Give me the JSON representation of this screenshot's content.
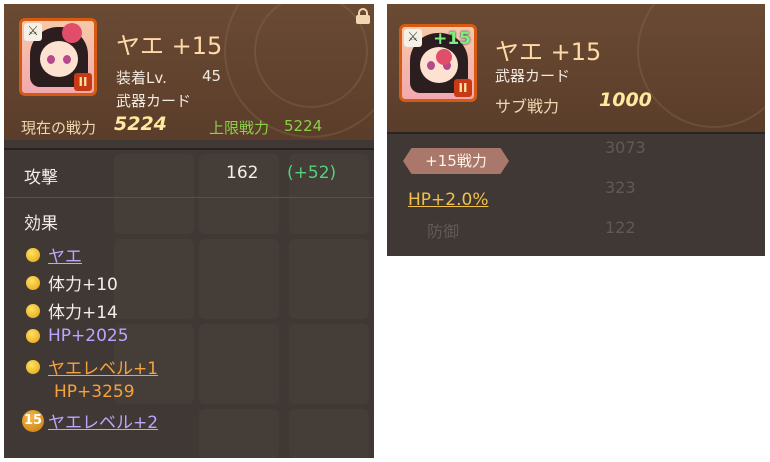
{
  "left_panel": {
    "card": {
      "rank": "II"
    },
    "title": "ヤエ +15",
    "equip_level_label": "装着Lv.",
    "equip_level_value": "45",
    "card_type": "武器カード",
    "current_power_label": "現在の戦力",
    "current_power_value": "5224",
    "limit_power_label": "上限戦力",
    "limit_power_value": "5224",
    "stat": {
      "label": "攻撃",
      "value": "162",
      "bonus": "(+52)"
    },
    "effects_title": "効果",
    "effects": [
      {
        "text": "ヤエ"
      },
      {
        "text": "体力+10"
      },
      {
        "text": "体力+14"
      },
      {
        "text": "HP+2025"
      },
      {
        "text": "ヤエレベル+1"
      },
      {
        "text": "HP+3259"
      },
      {
        "badge": "15",
        "text": "ヤエレベル+2"
      }
    ],
    "icons": [
      "lock-icon",
      "coin-icon",
      "sword-icon"
    ]
  },
  "right_panel": {
    "card": {
      "plus": "+15",
      "rank": "II"
    },
    "title": "ヤエ +15",
    "card_type": "武器カード",
    "sub_power_label": "サブ戦力",
    "sub_power_value": "1000",
    "tag": "+15戦力",
    "bonus_effect": "HP+2.0%"
  },
  "colors": {
    "panel_bg": "#3f3834",
    "header_bg": "#6a4a33",
    "card_border": "#d75a12",
    "limit_green": "#8ccf4a",
    "bonus_green": "#56d07a",
    "effect_purple": "#b9a7ff",
    "effect_orange": "#f7a23e",
    "hp_gold": "#f2c04a"
  }
}
